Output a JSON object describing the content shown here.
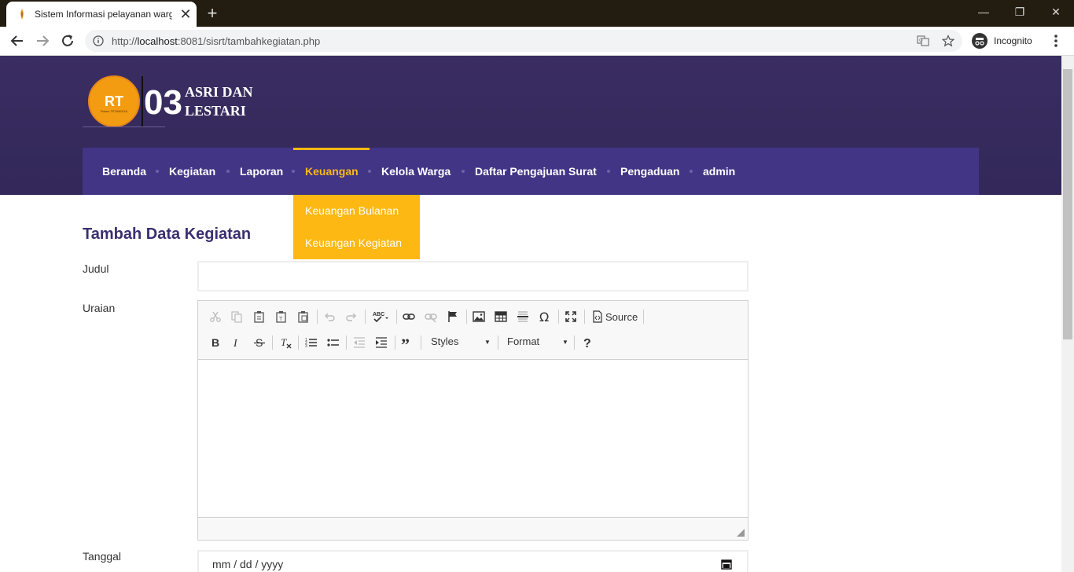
{
  "browser": {
    "tab_title": "Sistem Informasi pelayanan warga",
    "url_prefix": "http://",
    "url_host": "localhost",
    "url_rest": ":8081/sisrt/tambahkegiatan.php",
    "incognito_label": "Incognito",
    "close_glyph": "✕",
    "new_tab_glyph": "+",
    "minimize_glyph": "—",
    "restore_glyph": "❐",
    "window_close_glyph": "✕"
  },
  "site": {
    "logo": {
      "badge": "RT",
      "badge_sub": "Rukun TETANGGA",
      "number": "03",
      "line1": "ASRI DAN",
      "line2": "LESTARI"
    },
    "menu": [
      {
        "label": "Beranda"
      },
      {
        "label": "Kegiatan"
      },
      {
        "label": "Laporan"
      },
      {
        "label": "Keuangan",
        "active": true
      },
      {
        "label": "Kelola Warga"
      },
      {
        "label": "Daftar Pengajuan Surat"
      },
      {
        "label": "Pengaduan"
      },
      {
        "label": "admin"
      }
    ],
    "dropdown": [
      "Keuangan Bulanan",
      "Keuangan Kegiatan"
    ],
    "colors": {
      "header": "#3a2d62",
      "menu": "#423585",
      "accent": "#fdb813",
      "title": "#3b2f70"
    }
  },
  "form": {
    "title": "Tambah Data Kegiatan",
    "judul_label": "Judul",
    "judul_value": "",
    "uraian_label": "Uraian",
    "tanggal_label": "Tanggal",
    "tanggal_placeholder": "mm / dd / yyyy"
  },
  "editor": {
    "source_label": "Source",
    "styles_label": "Styles",
    "format_label": "Format",
    "arrow_glyph": "▼",
    "toolbar_row1": [
      "cut-icon",
      "copy-icon",
      "paste-icon",
      "paste-text-icon",
      "paste-word-icon",
      "undo-icon",
      "redo-icon",
      "spellcheck-icon",
      "link-icon",
      "unlink-icon",
      "anchor-icon",
      "image-icon",
      "table-icon",
      "horizontal-line-icon",
      "special-char-icon",
      "maximize-icon",
      "source-icon"
    ],
    "toolbar_row2": [
      "bold-icon",
      "italic-icon",
      "strike-icon",
      "remove-format-icon",
      "numbered-list-icon",
      "bulleted-list-icon",
      "outdent-icon",
      "indent-icon",
      "blockquote-icon",
      "styles-select",
      "format-select",
      "help-icon"
    ]
  }
}
